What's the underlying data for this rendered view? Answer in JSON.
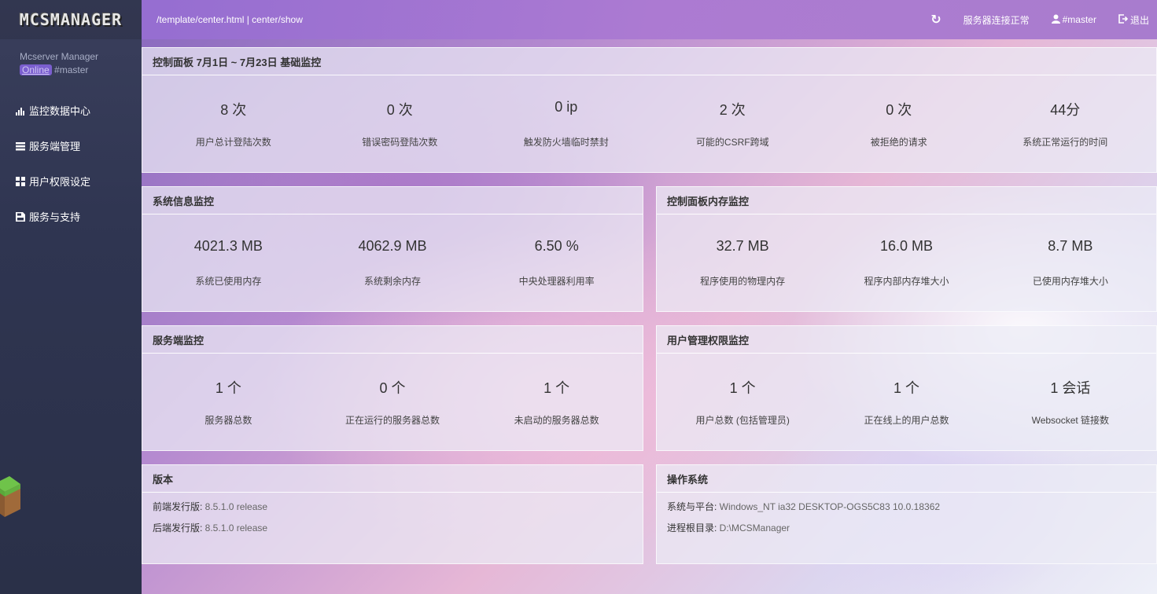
{
  "logo_text": "MCSMANAGER",
  "sidebar": {
    "app_name": "Mcserver Manager",
    "status_badge": "Online",
    "username": "#master",
    "items": [
      {
        "label": "监控数据中心",
        "icon": "bar-chart-icon"
      },
      {
        "label": "服务端管理",
        "icon": "server-list-icon"
      },
      {
        "label": "用户权限设定",
        "icon": "grid-icon"
      },
      {
        "label": "服务与支持",
        "icon": "bookmark-icon"
      }
    ]
  },
  "header": {
    "path": "/template/center.html | center/show",
    "status": "服务器连接正常",
    "user": "#master",
    "logout": "退出"
  },
  "panels": {
    "basic": {
      "title": "控制面板 7月1日 ~ 7月23日 基础监控",
      "stats": [
        {
          "value": "8 次",
          "label": "用户总计登陆次数"
        },
        {
          "value": "0 次",
          "label": "错误密码登陆次数"
        },
        {
          "value": "0 ip",
          "label": "触发防火墙临时禁封"
        },
        {
          "value": "2 次",
          "label": "可能的CSRF跨域"
        },
        {
          "value": "0 次",
          "label": "被拒绝的请求"
        },
        {
          "value": "44分",
          "label": "系统正常运行的时间"
        }
      ]
    },
    "system": {
      "title": "系统信息监控",
      "stats": [
        {
          "value": "4021.3 MB",
          "label": "系统已使用内存"
        },
        {
          "value": "4062.9 MB",
          "label": "系统剩余内存"
        },
        {
          "value": "6.50 %",
          "label": "中央处理器利用率"
        }
      ]
    },
    "memory": {
      "title": "控制面板内存监控",
      "stats": [
        {
          "value": "32.7 MB",
          "label": "程序使用的物理内存"
        },
        {
          "value": "16.0 MB",
          "label": "程序内部内存堆大小"
        },
        {
          "value": "8.7 MB",
          "label": "已使用内存堆大小"
        }
      ]
    },
    "servers": {
      "title": "服务端监控",
      "stats": [
        {
          "value": "1 个",
          "label": "服务器总数"
        },
        {
          "value": "0 个",
          "label": "正在运行的服务器总数"
        },
        {
          "value": "1 个",
          "label": "未启动的服务器总数"
        }
      ]
    },
    "users": {
      "title": "用户管理权限监控",
      "stats": [
        {
          "value": "1 个",
          "label": "用户总数 (包括管理员)"
        },
        {
          "value": "1 个",
          "label": "正在线上的用户总数"
        },
        {
          "value": "1 会话",
          "label": "Websocket 链接数"
        }
      ]
    },
    "version": {
      "title": "版本",
      "lines": [
        {
          "key": "前端发行版: ",
          "value": "8.5.1.0 release"
        },
        {
          "key": "后端发行版: ",
          "value": "8.5.1.0 release"
        }
      ]
    },
    "os": {
      "title": "操作系统",
      "lines": [
        {
          "key": "系统与平台: ",
          "value": "Windows_NT ia32 DESKTOP-OGS5C83 10.0.18362"
        },
        {
          "key": "进程根目录: ",
          "value": "D:\\MCSManager"
        }
      ]
    }
  }
}
